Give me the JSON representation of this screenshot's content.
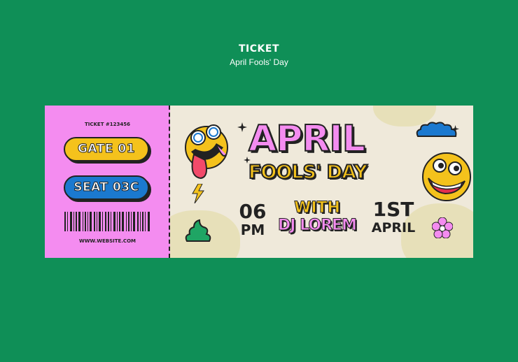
{
  "header": {
    "title": "TICKET",
    "subtitle": "April Fools' Day"
  },
  "stub": {
    "ticket_number": "TICKET #123456",
    "gate": "GATE 01",
    "seat": "SEAT 03C",
    "website": "WWW.WEBSITE.COM"
  },
  "main": {
    "headline": "APRIL",
    "subheadline": "FOOLS' DAY",
    "time_value": "06",
    "time_period": "PM",
    "with_label": "WITH",
    "performer": "DJ LOREM",
    "date_day": "1ST",
    "date_month": "APRIL"
  },
  "colors": {
    "background": "#0f8f57",
    "pink": "#f48cf0",
    "yellow": "#f4c21c",
    "blue": "#1b79cf",
    "cream": "#efe9da"
  },
  "icons": [
    "dizzy-face-icon",
    "grinning-face-icon",
    "cloud-icon",
    "lightning-icon",
    "sparkle-icon",
    "flower-icon",
    "slime-icon",
    "barcode-icon"
  ]
}
